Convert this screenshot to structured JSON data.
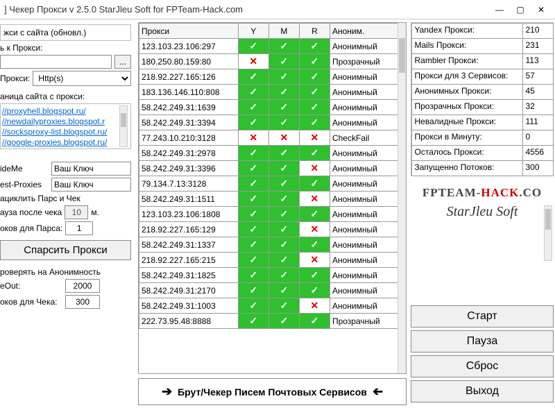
{
  "title": "] Чекер Прокси v 2.5.0     StarJleu Soft for FPTeam-Hack.com",
  "window": {
    "min": "—",
    "max": "▢",
    "close": "✕"
  },
  "left": {
    "update_label": "жси с сайта (обновл.)",
    "to_proxy_label": "ь к Прокси:",
    "browse": "...",
    "proxy_type_label": "Прокси:",
    "proxy_type_value": "Http(s)",
    "src_label": "аница сайта с прокси:",
    "links": [
      "//proxyhell.blogspot.ru/",
      "//newdailyproxies.blogspot.r",
      "//socksproxy-list.blogspot.ru/",
      "//google-proxies.blogspot.ru/"
    ],
    "hideme_label": "ideMe",
    "hideme_value": "Ваш Ключ",
    "bestproxies_label": "est-Proxies",
    "bestproxies_value": "Ваш Ключ",
    "loop_label": "ациклить Парс и Чек",
    "pause_after_label": "ауза после чека",
    "pause_after_value": "10",
    "pause_unit": "м.",
    "threads_parse_label": "оков для Парса:",
    "threads_parse_value": "1",
    "parse_btn": "Спарсить Прокси",
    "check_anon_label": "роверять на Анонимность",
    "timeout_label": "eOut:",
    "timeout_value": "2000",
    "threads_check_label": "оков для Чека:",
    "threads_check_value": "300"
  },
  "center": {
    "headers": {
      "proxy": "Прокси",
      "y": "Y",
      "m": "M",
      "r": "R",
      "anon": "Аноним."
    },
    "rows": [
      {
        "proxy": "123.103.23.106:297",
        "y": 1,
        "m": 1,
        "r": 1,
        "anon": "Анонимный"
      },
      {
        "proxy": "180.250.80.159:80",
        "y": 0,
        "m": 1,
        "r": 1,
        "anon": "Прозрачный"
      },
      {
        "proxy": "218.92.227.165:126",
        "y": 1,
        "m": 1,
        "r": 1,
        "anon": "Анонимный"
      },
      {
        "proxy": "183.136.146.110:808",
        "y": 1,
        "m": 1,
        "r": 1,
        "anon": "Анонимный"
      },
      {
        "proxy": "58.242.249.31:1639",
        "y": 1,
        "m": 1,
        "r": 1,
        "anon": "Анонимный"
      },
      {
        "proxy": "58.242.249.31:3394",
        "y": 1,
        "m": 1,
        "r": 1,
        "anon": "Анонимный"
      },
      {
        "proxy": "77.243.10.210:3128",
        "y": 0,
        "m": 0,
        "r": 0,
        "anon": "CheckFail"
      },
      {
        "proxy": "58.242.249.31:2978",
        "y": 1,
        "m": 1,
        "r": 1,
        "anon": "Анонимный"
      },
      {
        "proxy": "58.242.249.31:3396",
        "y": 1,
        "m": 1,
        "r": 0,
        "anon": "Анонимный"
      },
      {
        "proxy": "79.134.7.13:3128",
        "y": 1,
        "m": 1,
        "r": 1,
        "anon": "Анонимный"
      },
      {
        "proxy": "58.242.249.31:1511",
        "y": 1,
        "m": 1,
        "r": 0,
        "anon": "Анонимный"
      },
      {
        "proxy": "123.103.23.106:1808",
        "y": 1,
        "m": 1,
        "r": 1,
        "anon": "Анонимный"
      },
      {
        "proxy": "218.92.227.165:129",
        "y": 1,
        "m": 1,
        "r": 0,
        "anon": "Анонимный"
      },
      {
        "proxy": "58.242.249.31:1337",
        "y": 1,
        "m": 1,
        "r": 1,
        "anon": "Анонимный"
      },
      {
        "proxy": "218.92.227.165:215",
        "y": 1,
        "m": 1,
        "r": 0,
        "anon": "Анонимный"
      },
      {
        "proxy": "58.242.249.31:1825",
        "y": 1,
        "m": 1,
        "r": 1,
        "anon": "Анонимный"
      },
      {
        "proxy": "58.242.249.31:2170",
        "y": 1,
        "m": 1,
        "r": 1,
        "anon": "Анонимный"
      },
      {
        "proxy": "58.242.249.31:1003",
        "y": 1,
        "m": 1,
        "r": 0,
        "anon": "Анонимный"
      },
      {
        "proxy": "222.73.95.48:8888",
        "y": 1,
        "m": 1,
        "r": 1,
        "anon": "Прозрачный"
      }
    ],
    "brut_btn": "Брут/Чекер Писем Почтовых Сервисов"
  },
  "right": {
    "stats": [
      {
        "k": "Yandex Прокси:",
        "v": "210"
      },
      {
        "k": "Mails Прокси:",
        "v": "231"
      },
      {
        "k": "Rambler Прокси:",
        "v": "113"
      },
      {
        "k": "Прокси для 3 Сервисов:",
        "v": "57"
      },
      {
        "k": "Анонимных Прокси:",
        "v": "45"
      },
      {
        "k": "Прозрачных Прокси:",
        "v": "32"
      },
      {
        "k": "Невалидные Прокси:",
        "v": "111"
      },
      {
        "k": "Прокси в Минуту:",
        "v": "0"
      },
      {
        "k": "Осталось Прокси:",
        "v": "4556"
      },
      {
        "k": "Запущенно Потоков:",
        "v": "300"
      }
    ],
    "brand1a": "FPTEAM-",
    "brand1b": "HACK",
    "brand1c": ".CO",
    "brand2": "StarJleu Soft",
    "btn_start": "Старт",
    "btn_pause": "Пауза",
    "btn_reset": "Сброс",
    "btn_exit": "Выход"
  }
}
